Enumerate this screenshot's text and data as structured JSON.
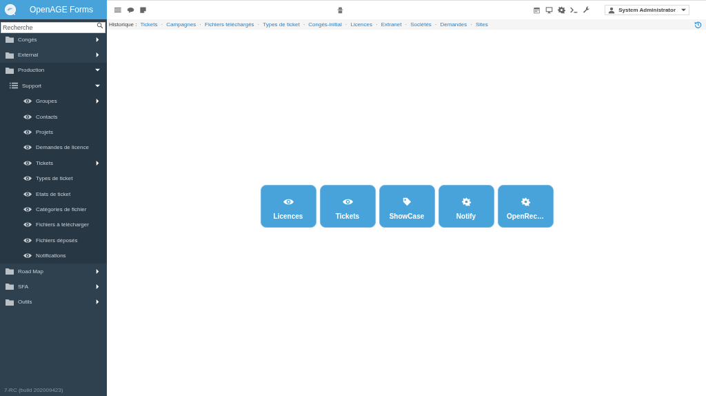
{
  "app": {
    "title": "OpenAGE Forms"
  },
  "search": {
    "placeholder": "Recherche"
  },
  "sidebar": {
    "items": [
      {
        "label": "Congés",
        "kind": "folder",
        "expanded": false
      },
      {
        "label": "External",
        "kind": "folder",
        "expanded": false
      },
      {
        "label": "Production",
        "kind": "folder",
        "expanded": true,
        "children": [
          {
            "label": "Support",
            "kind": "list",
            "expanded": true,
            "children": [
              {
                "label": "Groupes",
                "kind": "view",
                "expanded": false
              },
              {
                "label": "Contacts",
                "kind": "view"
              },
              {
                "label": "Projets",
                "kind": "view"
              },
              {
                "label": "Demandes de licence",
                "kind": "view"
              },
              {
                "label": "Tickets",
                "kind": "view",
                "expanded": false
              },
              {
                "label": "Types de ticket",
                "kind": "view"
              },
              {
                "label": "Etats de ticket",
                "kind": "view"
              },
              {
                "label": "Catégories de fichier",
                "kind": "view"
              },
              {
                "label": "Fichiers à télécharger",
                "kind": "view"
              },
              {
                "label": "Fichiers déposés",
                "kind": "view"
              },
              {
                "label": "Notifications",
                "kind": "view"
              }
            ]
          }
        ]
      },
      {
        "label": "Road Map",
        "kind": "folder",
        "expanded": false
      },
      {
        "label": "SFA",
        "kind": "folder",
        "expanded": false
      },
      {
        "label": "Outils",
        "kind": "folder",
        "expanded": false
      }
    ]
  },
  "version": "7-RC (build 202009423)",
  "user": {
    "name": "System Administrator"
  },
  "history": {
    "label": "Historique :",
    "separator": "·",
    "links": [
      "Tickets",
      "Campagnes",
      "Fichiers téléchargés",
      "Types de ticket",
      "Congés-initial",
      "Licences",
      "Extranet",
      "Sociétés",
      "Demandes",
      "Sites"
    ]
  },
  "tiles": [
    {
      "label": "Licences",
      "kind": "eye"
    },
    {
      "label": "Tickets",
      "kind": "eye"
    },
    {
      "label": "ShowCase",
      "kind": "tag"
    },
    {
      "label": "Notify",
      "kind": "gear"
    },
    {
      "label": "OpenRec…",
      "kind": "gear"
    }
  ]
}
